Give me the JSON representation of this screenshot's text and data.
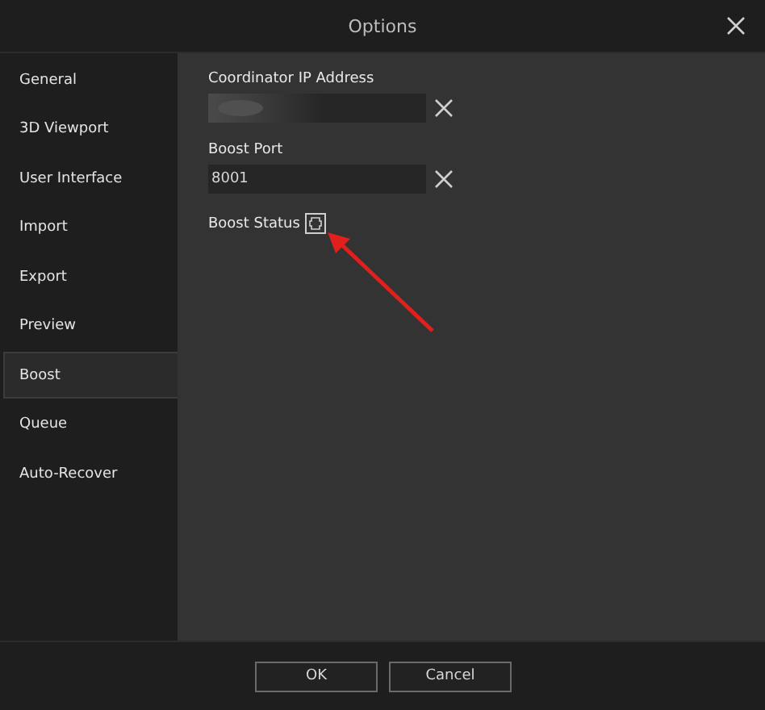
{
  "window": {
    "title": "Options"
  },
  "sidebar": {
    "items": [
      {
        "label": "General",
        "selected": false
      },
      {
        "label": "3D Viewport",
        "selected": false
      },
      {
        "label": "User Interface",
        "selected": false
      },
      {
        "label": "Import",
        "selected": false
      },
      {
        "label": "Export",
        "selected": false
      },
      {
        "label": "Preview",
        "selected": false
      },
      {
        "label": "Boost",
        "selected": true
      },
      {
        "label": "Queue",
        "selected": false
      },
      {
        "label": "Auto-Recover",
        "selected": false
      }
    ]
  },
  "settings": [
    {
      "kind": "text",
      "label": "Coordinator IP Address",
      "blurred": true
    },
    {
      "kind": "text",
      "label": "Boost Port",
      "value": "8001"
    },
    {
      "kind": "status",
      "label": "Boost Status"
    }
  ],
  "buttons": [
    "OK",
    "Cancel"
  ]
}
